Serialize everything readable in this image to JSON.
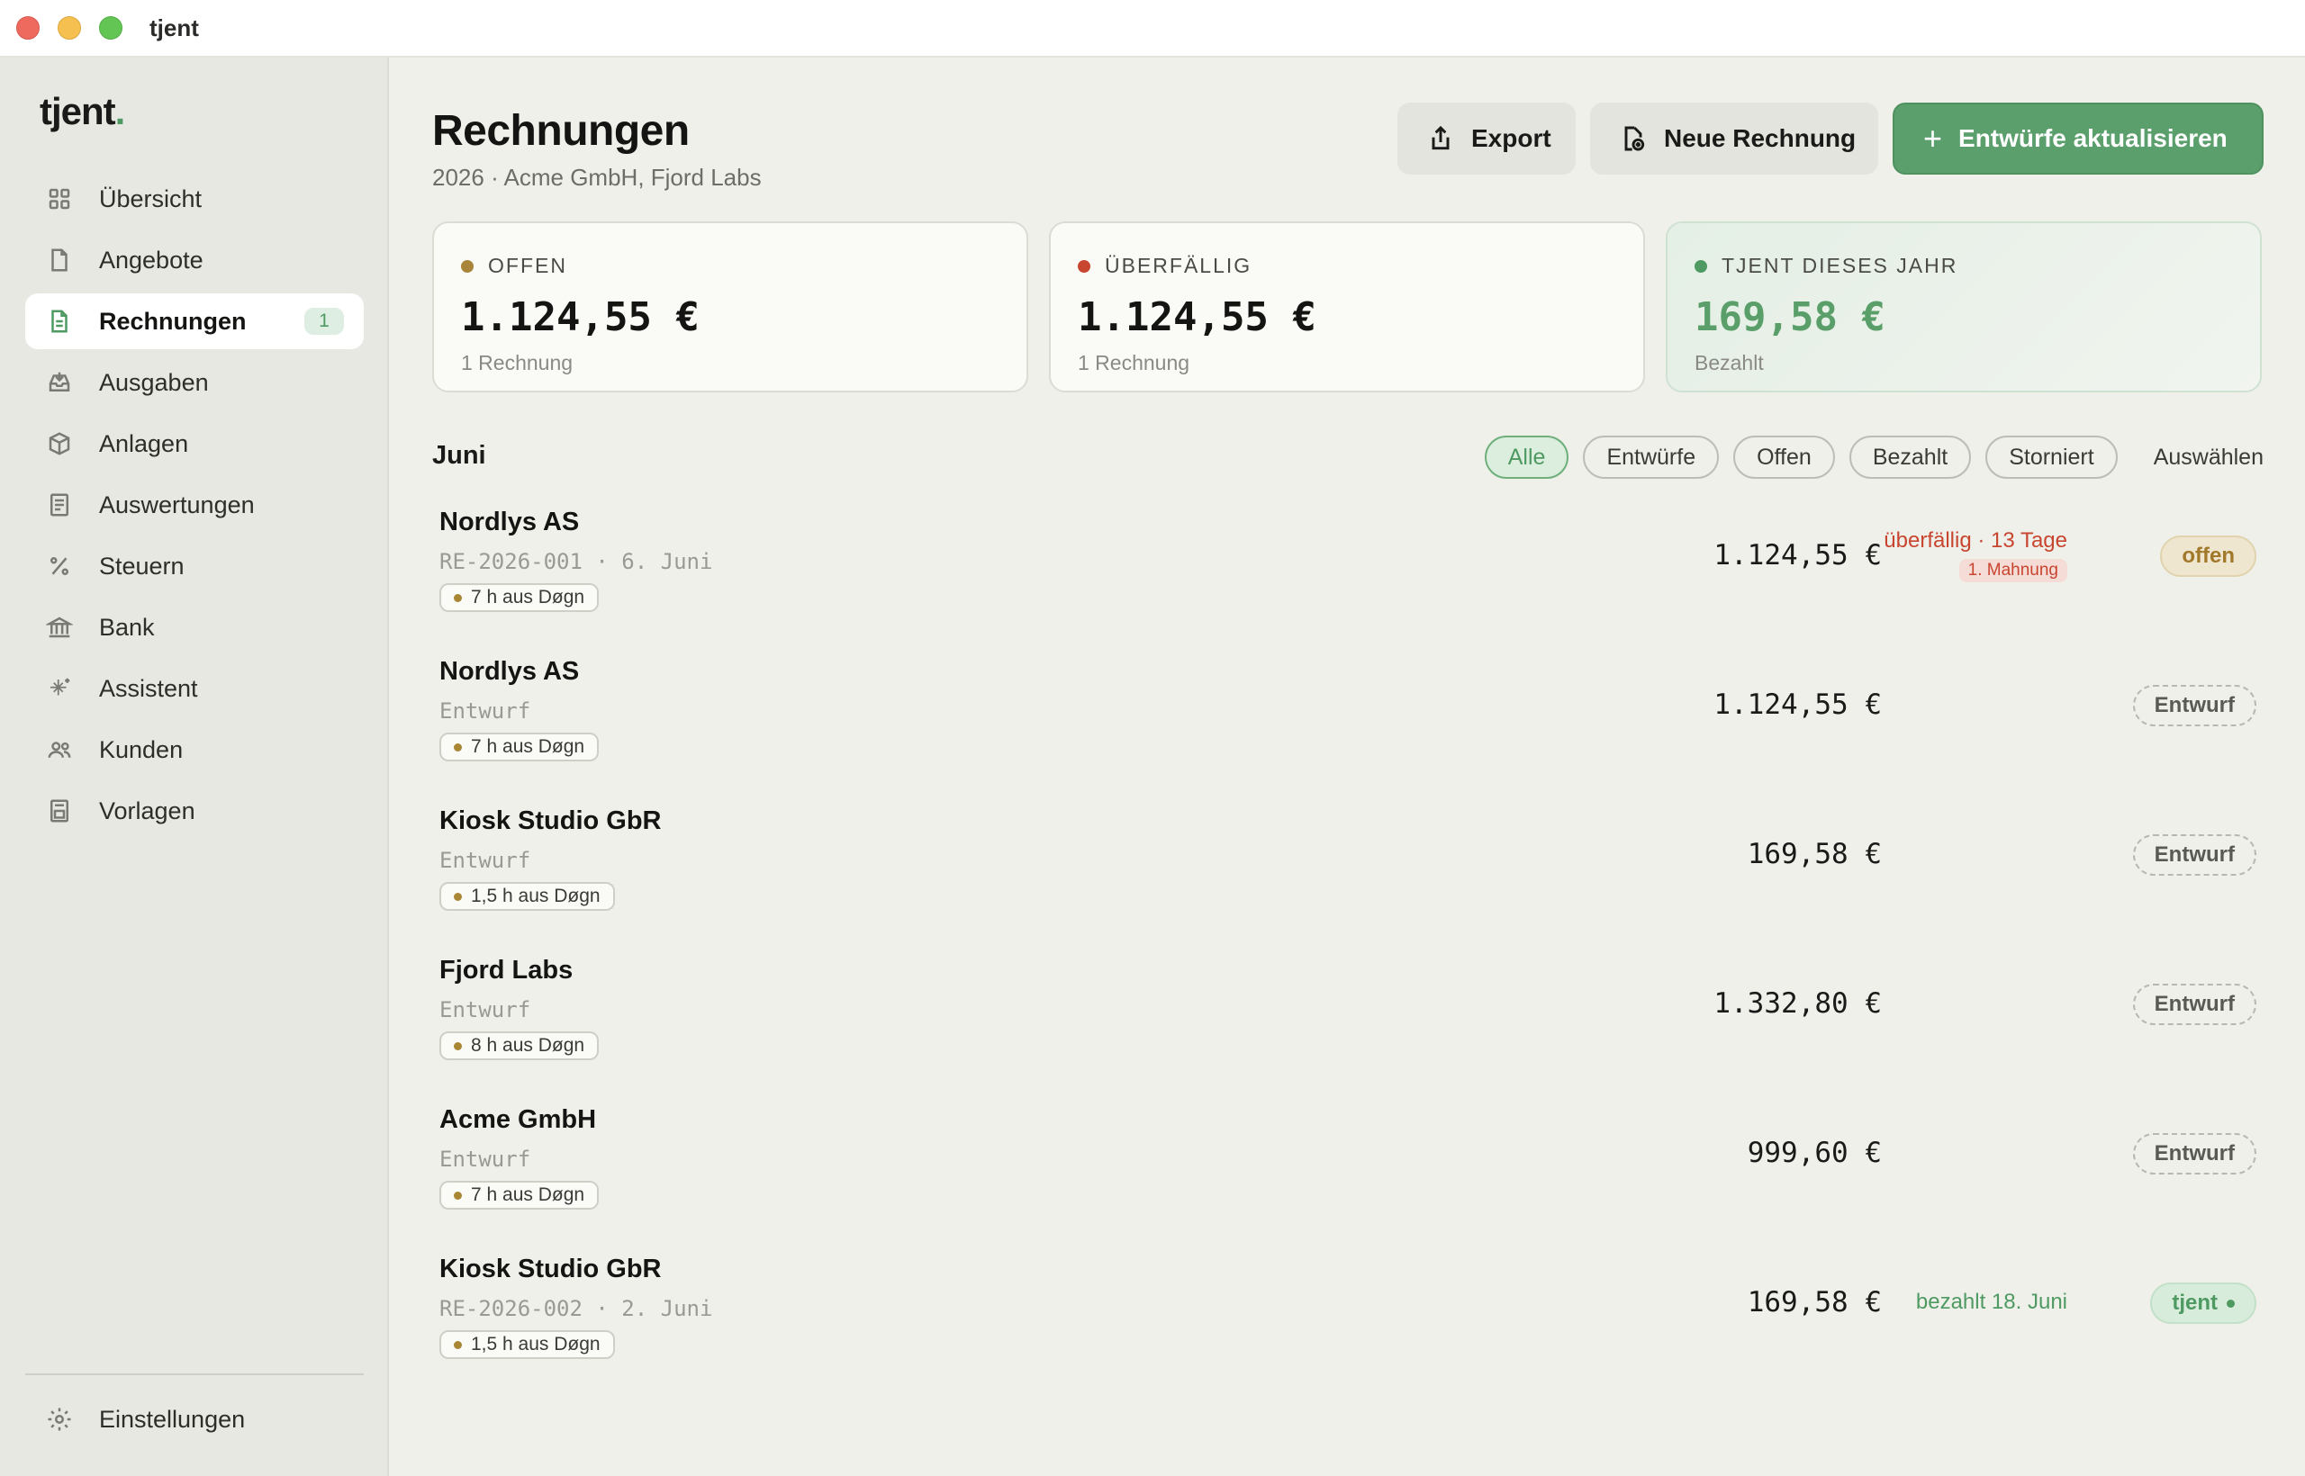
{
  "window": {
    "title": "tjent"
  },
  "brand": {
    "name": "tjent",
    "dot": ".",
    "accent": "#4f9a63"
  },
  "sidebar": {
    "items": [
      {
        "label": "Übersicht",
        "icon": "grid-icon"
      },
      {
        "label": "Angebote",
        "icon": "document-icon"
      },
      {
        "label": "Rechnungen",
        "icon": "invoice-icon",
        "badge": "1",
        "active": true
      },
      {
        "label": "Ausgaben",
        "icon": "inbox-icon"
      },
      {
        "label": "Anlagen",
        "icon": "box-icon"
      },
      {
        "label": "Auswertungen",
        "icon": "report-icon"
      },
      {
        "label": "Steuern",
        "icon": "percent-icon"
      },
      {
        "label": "Bank",
        "icon": "bank-icon"
      },
      {
        "label": "Assistent",
        "icon": "sparkle-icon"
      },
      {
        "label": "Kunden",
        "icon": "users-icon"
      },
      {
        "label": "Vorlagen",
        "icon": "template-icon"
      }
    ],
    "settings_label": "Einstellungen"
  },
  "header": {
    "title": "Rechnungen",
    "subtitle": "2026 · Acme GmbH, Fjord Labs",
    "export_label": "Export",
    "new_label": "Neue Rechnung",
    "primary_label": "Entwürfe aktualisieren",
    "primary_prefix": "+"
  },
  "stats": [
    {
      "label": "OFFEN",
      "value": "1.124,55 €",
      "note": "1 Rechnung",
      "dot_color": "#a8853a"
    },
    {
      "label": "ÜBERFÄLLIG",
      "value": "1.124,55 €",
      "note": "1 Rechnung",
      "dot_color": "#c8452f"
    },
    {
      "label": "TJENT DIESES JAHR",
      "value": "169,58 €",
      "note": "Bezahlt",
      "dot_color": "#4f9a63"
    }
  ],
  "list": {
    "month": "Juni",
    "filters": [
      "Alle",
      "Entwürfe",
      "Offen",
      "Bezahlt",
      "Storniert"
    ],
    "active_filter": "Alle",
    "select_label": "Auswählen",
    "rows": [
      {
        "client": "Nordlys AS",
        "meta": "RE-2026-001 · 6. Juni",
        "tag": "7 h aus Døgn",
        "amount": "1.124,55 €",
        "note": "überfällig · 13 Tage",
        "reminder": "1. Mahnung",
        "status": "offen",
        "status_type": "open"
      },
      {
        "client": "Nordlys AS",
        "meta": "Entwurf",
        "tag": "7 h aus Døgn",
        "amount": "1.124,55 €",
        "status": "Entwurf",
        "status_type": "draft"
      },
      {
        "client": "Kiosk Studio GbR",
        "meta": "Entwurf",
        "tag": "1,5 h aus Døgn",
        "amount": "169,58 €",
        "status": "Entwurf",
        "status_type": "draft"
      },
      {
        "client": "Fjord Labs",
        "meta": "Entwurf",
        "tag": "8 h aus Døgn",
        "amount": "1.332,80 €",
        "status": "Entwurf",
        "status_type": "draft"
      },
      {
        "client": "Acme GmbH",
        "meta": "Entwurf",
        "tag": "7 h aus Døgn",
        "amount": "999,60 €",
        "status": "Entwurf",
        "status_type": "draft"
      },
      {
        "client": "Kiosk Studio GbR",
        "meta": "RE-2026-002 · 2. Juni",
        "tag": "1,5 h aus Døgn",
        "amount": "169,58 €",
        "paid_note": "bezahlt 18. Juni",
        "status": "tjent",
        "status_type": "paid"
      }
    ]
  }
}
